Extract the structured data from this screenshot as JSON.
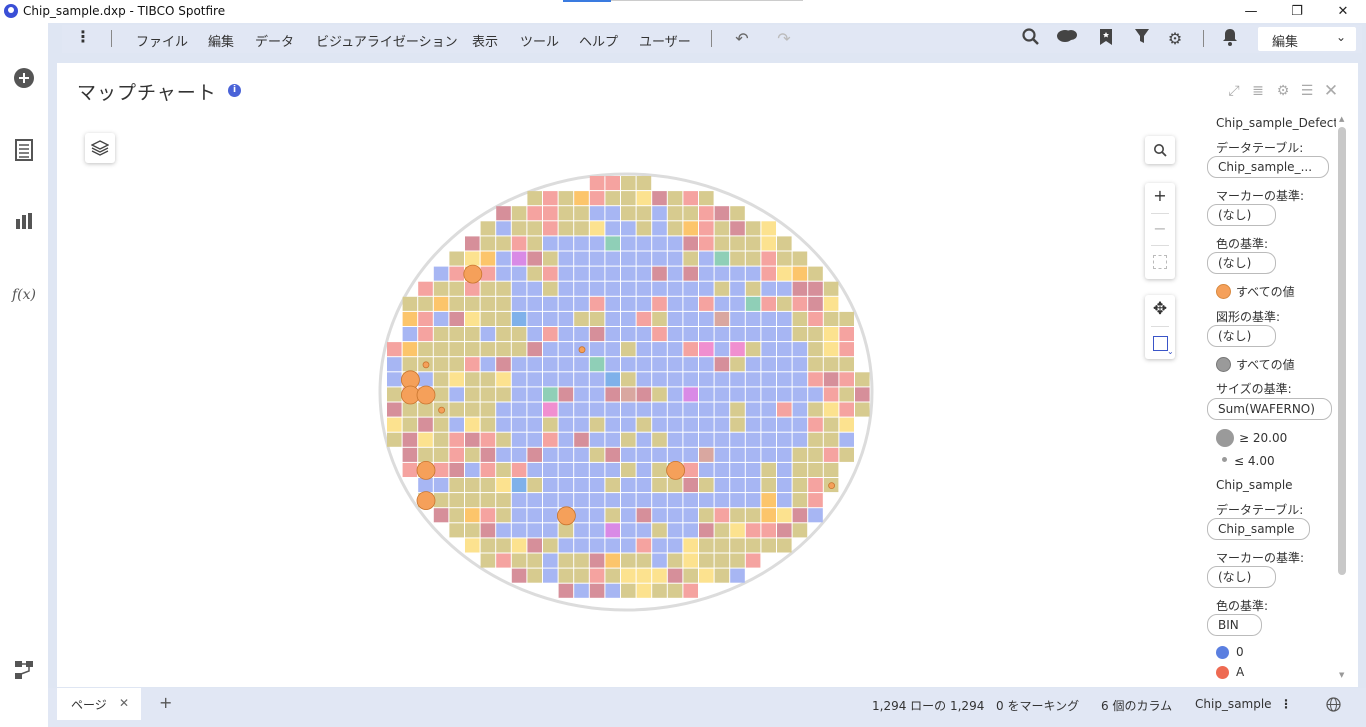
{
  "window": {
    "title": "Chip_sample.dxp - TIBCO Spotfire",
    "minimize": "—",
    "maximize": "❐",
    "close": "✕"
  },
  "menu": {
    "items": [
      "ファイル",
      "編集",
      "データ",
      "ビジュアライゼーション",
      "表示",
      "ツール",
      "ヘルプ",
      "ユーザー"
    ],
    "mode": "編集"
  },
  "visualization": {
    "title": "マップチャート",
    "info": "i"
  },
  "legend": {
    "layer1_title": "Chip_sample_Defect_d",
    "data_table_label": "データテーブル:",
    "layer1_table": "Chip_sample_...",
    "marker_label": "マーカーの基準:",
    "marker_value": "(なし)",
    "color_label": "色の基準:",
    "color_value": "(なし)",
    "all_values": "すべての値",
    "shape_label": "図形の基準:",
    "shape_value": "(なし)",
    "all_values_2": "すべての値",
    "size_label": "サイズの基準:",
    "size_value": "Sum(WAFERNO)",
    "size_max": "≥ 20.00",
    "size_min": "≤ 4.00",
    "layer2_title": "Chip_sample",
    "data_table_label_2": "データテーブル:",
    "layer2_table": "Chip_sample",
    "marker_label_2": "マーカーの基準:",
    "marker_value_2": "(なし)",
    "color_label_2": "色の基準:",
    "color_value_2": "BIN",
    "bin0": "0",
    "binA": "A",
    "accent_orange": "#f5a05a",
    "shape_gray": "#9a9a9a",
    "bin0_color": "#5b7fe0",
    "binA_color": "#ee6a52"
  },
  "status": {
    "page_tab": "ページ",
    "close_tab": "✕",
    "add_page": "+",
    "rows": "1,294 ローの 1,294",
    "marking": "0 をマーキング",
    "columns": "6 個のカラム",
    "table": "Chip_sample",
    "more": "⋮"
  },
  "map_colors": {
    "blue": "#a7b6f3",
    "khaki": "#d7cb8f",
    "rose": "#d68f9a",
    "salmon": "#f5a3a0",
    "yellow": "#fce28f",
    "orange": "#fcc56b",
    "magenta": "#d98ae6",
    "pink": "#f08fd0",
    "teal": "#8fcfb7",
    "sky": "#7fb1ea",
    "taupe": "#d9a7a0",
    "defect": "#f5a05a"
  },
  "wafer_defects": [
    {
      "col": 5,
      "row": 6,
      "size": 4
    },
    {
      "col": 1,
      "row": 13,
      "size": 4
    },
    {
      "col": 1,
      "row": 14,
      "size": 4
    },
    {
      "col": 2,
      "row": 14,
      "size": 4
    },
    {
      "col": 2,
      "row": 19,
      "size": 4
    },
    {
      "col": 2,
      "row": 21,
      "size": 4
    },
    {
      "col": 18,
      "row": 19,
      "size": 4
    },
    {
      "col": 11,
      "row": 22,
      "size": 4
    },
    {
      "col": 2,
      "row": 12,
      "size": 1
    },
    {
      "col": 3,
      "row": 15,
      "size": 1
    },
    {
      "col": 12,
      "row": 11,
      "size": 1
    },
    {
      "col": 28,
      "row": 20,
      "size": 1
    }
  ]
}
